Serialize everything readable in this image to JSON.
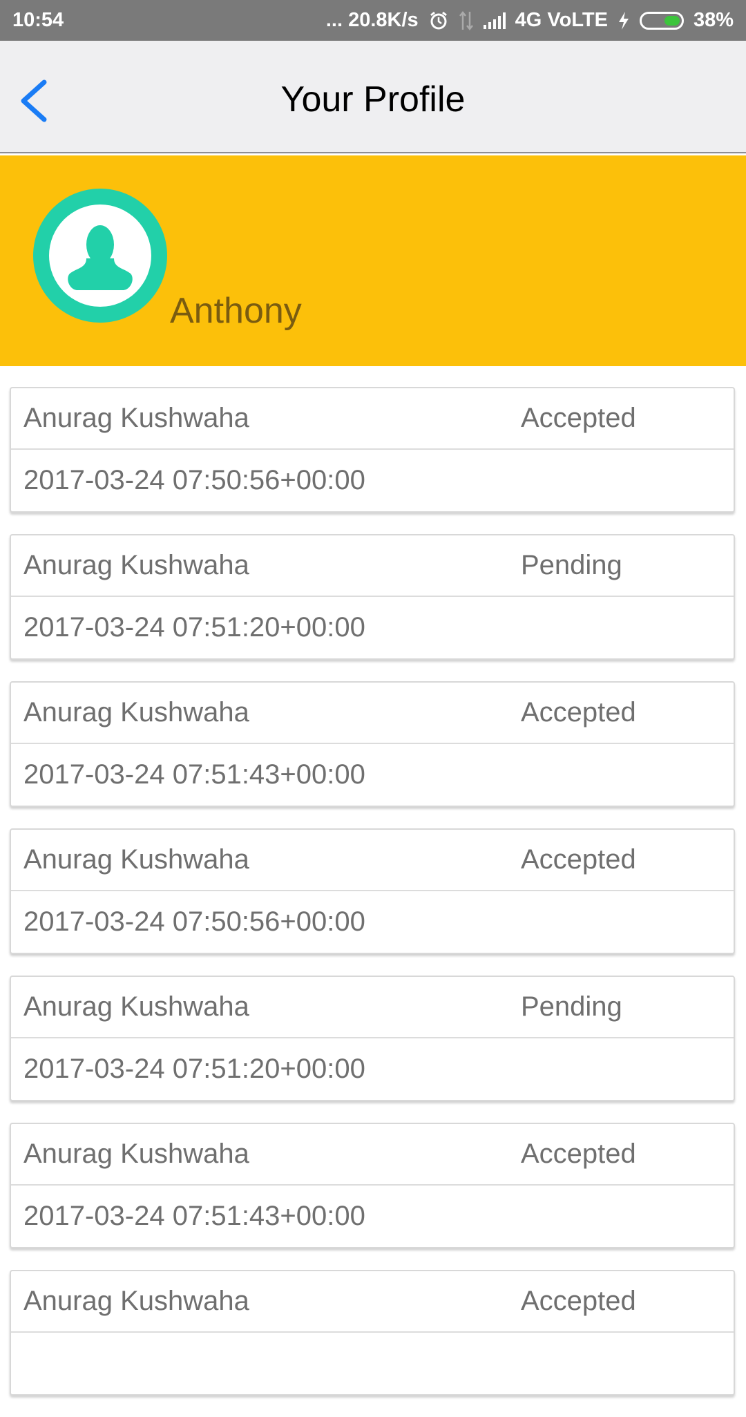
{
  "status_bar": {
    "time": "10:54",
    "network_speed": "... 20.8K/s",
    "network_type": "4G VoLTE",
    "battery": "38%",
    "battery_level": 0.38,
    "battery_color": "#3cc43c",
    "icons": [
      "alarm-icon",
      "data-arrows-icon",
      "signal-icon",
      "charging-icon",
      "battery-icon"
    ]
  },
  "nav": {
    "back_icon": "chevron-left-icon",
    "title": "Your Profile",
    "accent_color": "#1a7cf5"
  },
  "profile": {
    "name": "Anthony",
    "avatar_icon": "user-silhouette-icon",
    "header_color": "#fcc00a",
    "avatar_color": "#22d0a9"
  },
  "requests": [
    {
      "name": "Anurag Kushwaha",
      "status": "Accepted",
      "timestamp": "2017-03-24 07:50:56+00:00"
    },
    {
      "name": "Anurag Kushwaha",
      "status": "Pending",
      "timestamp": "2017-03-24 07:51:20+00:00"
    },
    {
      "name": "Anurag Kushwaha",
      "status": "Accepted",
      "timestamp": "2017-03-24 07:51:43+00:00"
    },
    {
      "name": "Anurag Kushwaha",
      "status": "Accepted",
      "timestamp": "2017-03-24 07:50:56+00:00"
    },
    {
      "name": "Anurag Kushwaha",
      "status": "Pending",
      "timestamp": "2017-03-24 07:51:20+00:00"
    },
    {
      "name": "Anurag Kushwaha",
      "status": "Accepted",
      "timestamp": "2017-03-24 07:51:43+00:00"
    },
    {
      "name": "Anurag Kushwaha",
      "status": "Accepted",
      "timestamp": ""
    }
  ]
}
